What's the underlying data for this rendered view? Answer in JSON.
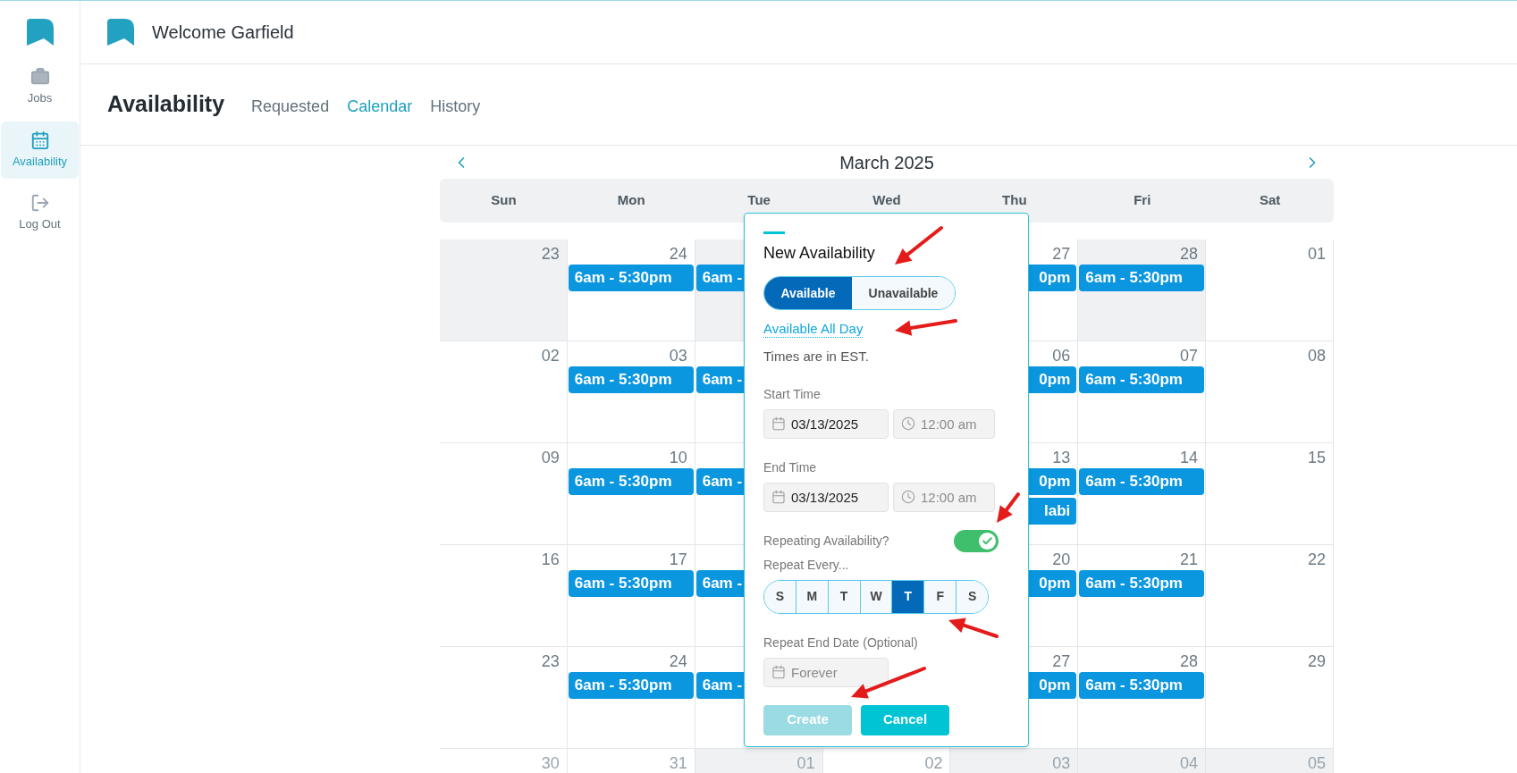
{
  "sidebar": {
    "items": [
      {
        "label": "Jobs",
        "selected": false
      },
      {
        "label": "Availability",
        "selected": true
      },
      {
        "label": "Log Out",
        "selected": false
      }
    ]
  },
  "header": {
    "greeting": "Welcome Garfield"
  },
  "page": {
    "title": "Availability",
    "tabs": [
      {
        "label": "Requested",
        "selected": false
      },
      {
        "label": "Calendar",
        "selected": true
      },
      {
        "label": "History",
        "selected": false
      }
    ]
  },
  "calendar": {
    "month": "March 2025",
    "weekdays": [
      "Sun",
      "Mon",
      "Tue",
      "Wed",
      "Thu",
      "Fri",
      "Sat"
    ],
    "weeks": [
      {
        "days": [
          {
            "label": "23",
            "muted": true
          },
          {
            "label": "24",
            "muted": false,
            "events": [
              {
                "text": "6am - 5:30pm",
                "cut_start": false
              }
            ]
          },
          {
            "muted": true,
            "events": [
              {
                "text": "6am -",
                "cut_start": false
              }
            ]
          },
          {
            "label": "27",
            "muted": false,
            "events": [
              {
                "text": "0pm",
                "cut_start": true
              }
            ]
          },
          {
            "label": "28",
            "muted": true,
            "events": [
              {
                "text": "6am - 5:30pm",
                "cut_start": false
              }
            ]
          },
          {
            "label": "01",
            "muted": false
          }
        ]
      },
      {
        "days": [
          {
            "label": "02",
            "muted": false
          },
          {
            "label": "03",
            "muted": false,
            "events": [
              {
                "text": "6am - 5:30pm",
                "cut_start": false
              }
            ]
          },
          {
            "muted": false,
            "events": [
              {
                "text": "6am -",
                "cut_start": false
              }
            ]
          },
          {
            "label": "06",
            "muted": false,
            "events": [
              {
                "text": "0pm",
                "cut_start": true
              }
            ]
          },
          {
            "label": "07",
            "muted": false,
            "events": [
              {
                "text": "6am - 5:30pm",
                "cut_start": false
              }
            ]
          },
          {
            "label": "08",
            "muted": false
          }
        ]
      },
      {
        "days": [
          {
            "label": "09",
            "muted": false
          },
          {
            "label": "10",
            "muted": false,
            "events": [
              {
                "text": "6am - 5:30pm",
                "cut_start": false
              }
            ]
          },
          {
            "muted": false,
            "events": [
              {
                "text": "6am -",
                "cut_start": false
              }
            ]
          },
          {
            "label": "13",
            "muted": false,
            "events": [
              {
                "text": "0pm",
                "cut_start": true
              },
              {
                "text": "labi",
                "cut_start": true
              }
            ]
          },
          {
            "label": "14",
            "muted": false,
            "events": [
              {
                "text": "6am - 5:30pm",
                "cut_start": false
              }
            ]
          },
          {
            "label": "15",
            "muted": false
          }
        ]
      },
      {
        "days": [
          {
            "label": "16",
            "muted": false
          },
          {
            "label": "17",
            "muted": false,
            "events": [
              {
                "text": "6am - 5:30pm",
                "cut_start": false
              }
            ]
          },
          {
            "muted": false,
            "events": [
              {
                "text": "6am -",
                "cut_start": false
              }
            ]
          },
          {
            "label": "20",
            "muted": false,
            "events": [
              {
                "text": "0pm",
                "cut_start": true
              }
            ]
          },
          {
            "label": "21",
            "muted": false,
            "events": [
              {
                "text": "6am - 5:30pm",
                "cut_start": false
              }
            ]
          },
          {
            "label": "22",
            "muted": false
          }
        ]
      },
      {
        "days": [
          {
            "label": "23",
            "muted": false
          },
          {
            "label": "24",
            "muted": false,
            "events": [
              {
                "text": "6am - 5:30pm",
                "cut_start": false
              }
            ]
          },
          {
            "muted": false,
            "events": [
              {
                "text": "6am -",
                "cut_start": false
              }
            ]
          },
          {
            "label": "27",
            "muted": false,
            "events": [
              {
                "text": "0pm",
                "cut_start": true
              }
            ]
          },
          {
            "label": "28",
            "muted": false,
            "events": [
              {
                "text": "6am - 5:30pm",
                "cut_start": false
              }
            ]
          },
          {
            "label": "29",
            "muted": false
          }
        ]
      },
      {
        "days": [
          {
            "label": "30",
            "muted": false
          },
          {
            "label": "31",
            "muted": false
          },
          {
            "label": "01",
            "muted": true
          },
          {
            "label": "02",
            "muted": false
          },
          {
            "label": "03",
            "muted": true
          },
          {
            "label": "04",
            "muted": true
          },
          {
            "label": "05",
            "muted": true
          }
        ]
      }
    ]
  },
  "dialog": {
    "title": "New Availability",
    "mode_options": [
      {
        "label": "Available",
        "selected": true
      },
      {
        "label": "Unavailable",
        "selected": false
      }
    ],
    "all_day_link": "Available All Day",
    "timezone_note": "Times are in EST.",
    "start_time": {
      "label": "Start Time",
      "date": "03/13/2025",
      "time": "12:00 am"
    },
    "end_time": {
      "label": "End Time",
      "date": "03/13/2025",
      "time": "12:00 am"
    },
    "repeating": {
      "label": "Repeating Availability?",
      "on": true
    },
    "repeat_every": {
      "label": "Repeat Every...",
      "days": [
        {
          "label": "S",
          "selected": false
        },
        {
          "label": "M",
          "selected": false
        },
        {
          "label": "T",
          "selected": false
        },
        {
          "label": "W",
          "selected": false
        },
        {
          "label": "T",
          "selected": true
        },
        {
          "label": "F",
          "selected": false
        },
        {
          "label": "S",
          "selected": false
        }
      ]
    },
    "repeat_end": {
      "label": "Repeat End Date (Optional)",
      "placeholder": "Forever"
    },
    "buttons": [
      {
        "label": "Create",
        "kind": "primary",
        "disabled": true
      },
      {
        "label": "Cancel",
        "kind": "primary",
        "disabled": false
      }
    ]
  }
}
